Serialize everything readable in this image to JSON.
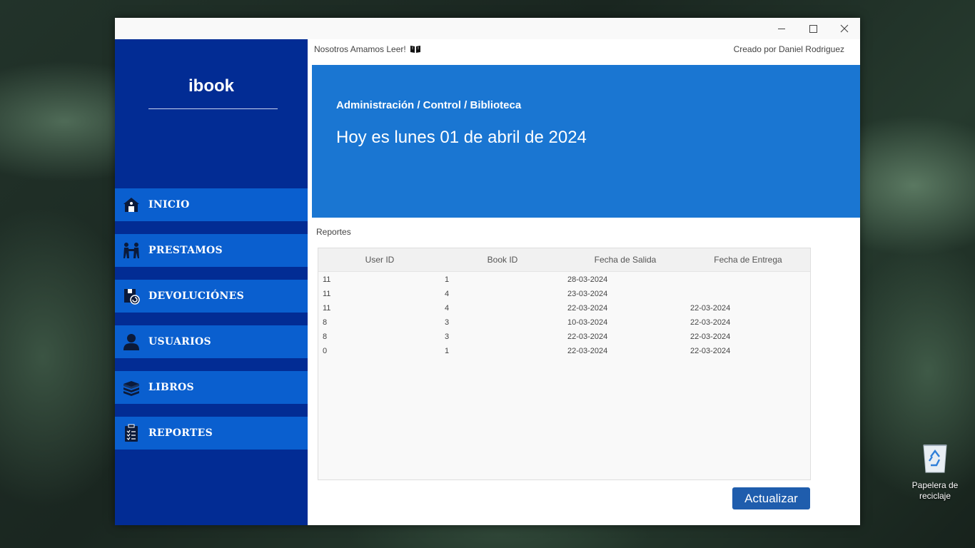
{
  "window": {
    "controls": {
      "minimize": "",
      "maximize": "",
      "close": ""
    }
  },
  "sidebar": {
    "brand": "ibook",
    "items": [
      {
        "label": "INICIO",
        "icon": "home-icon"
      },
      {
        "label": "PRESTAMOS",
        "icon": "handshake-icon"
      },
      {
        "label": "DEVOLUCIÓNES",
        "icon": "return-box-icon"
      },
      {
        "label": "USUARIOS",
        "icon": "user-icon"
      },
      {
        "label": "LIBROS",
        "icon": "books-icon"
      },
      {
        "label": "REPORTES",
        "icon": "clipboard-icon"
      }
    ]
  },
  "topbar": {
    "tagline": "Nosotros Amamos Leer!",
    "tagline_icon": "open-book-icon",
    "credit": "Creado por Daniel Rodriguez"
  },
  "hero": {
    "breadcrumb": "Administración / Control / Biblioteca",
    "date_text": "Hoy es lunes 01 de abril de 2024"
  },
  "reports": {
    "title": "Reportes",
    "columns": [
      "User ID",
      "Book ID",
      "Fecha de Salida",
      "Fecha de Entrega"
    ],
    "rows": [
      [
        "11",
        "1",
        "28-03-2024",
        ""
      ],
      [
        "11",
        "4",
        "23-03-2024",
        ""
      ],
      [
        "11",
        "4",
        "22-03-2024",
        "22-03-2024"
      ],
      [
        "8",
        "3",
        "10-03-2024",
        "22-03-2024"
      ],
      [
        "8",
        "3",
        "22-03-2024",
        "22-03-2024"
      ],
      [
        "0",
        "1",
        "22-03-2024",
        "22-03-2024"
      ]
    ],
    "refresh_button": "Actualizar"
  },
  "desktop": {
    "recycle_bin_label": "Papelera de reciclaje"
  },
  "colors": {
    "sidebar_bg": "#022c94",
    "nav_item_bg": "#0a5fcf",
    "hero_bg": "#1a76d2",
    "button_bg": "#1f5dad"
  }
}
